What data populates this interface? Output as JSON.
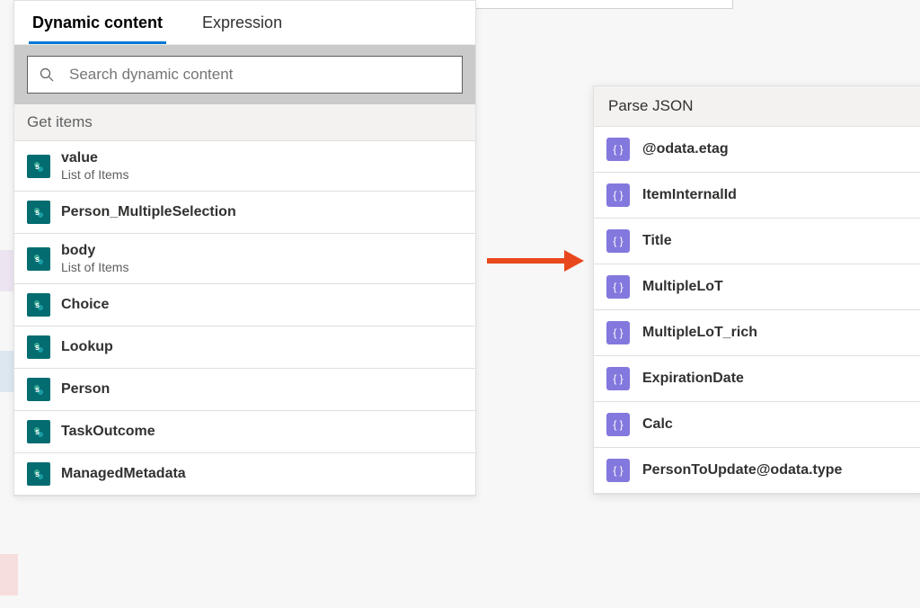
{
  "tabs": {
    "dynamic": "Dynamic content",
    "expression": "Expression"
  },
  "search": {
    "placeholder": "Search dynamic content"
  },
  "left_section": {
    "header": "Get items",
    "items": [
      {
        "title": "value",
        "desc": "List of Items"
      },
      {
        "title": "Person_MultipleSelection",
        "desc": ""
      },
      {
        "title": "body",
        "desc": "List of Items"
      },
      {
        "title": "Choice",
        "desc": ""
      },
      {
        "title": "Lookup",
        "desc": ""
      },
      {
        "title": "Person",
        "desc": ""
      },
      {
        "title": "TaskOutcome",
        "desc": ""
      },
      {
        "title": "ManagedMetadata",
        "desc": ""
      }
    ]
  },
  "right_section": {
    "header": "Parse JSON",
    "items": [
      "@odata.etag",
      "ItemInternalId",
      "Title",
      "MultipleLoT",
      "MultipleLoT_rich",
      "ExpirationDate",
      "Calc",
      "PersonToUpdate@odata.type"
    ]
  },
  "colors": {
    "accent_blue": "#0078d4",
    "sharepoint_teal": "#036c70",
    "json_purple": "#8378de",
    "arrow_red": "#e8481c"
  }
}
